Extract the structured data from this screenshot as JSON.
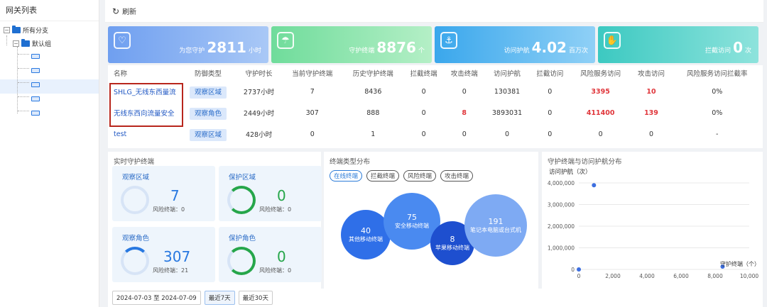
{
  "sidebar": {
    "title": "网关列表",
    "root": "所有分支",
    "group": "默认组"
  },
  "toolbar": {
    "refresh_label": "刷新"
  },
  "cards": [
    {
      "prefix": "为您守护",
      "value": "2811",
      "unit": "小时"
    },
    {
      "prefix": "守护终端",
      "value": "8876",
      "unit": "个"
    },
    {
      "prefix": "访问护航",
      "value": "4.02",
      "unit": "百万次"
    },
    {
      "prefix": "拦截访问",
      "value": "0",
      "unit": "次"
    }
  ],
  "table": {
    "headers": [
      "名称",
      "防御类型",
      "守护时长",
      "当前守护终端",
      "历史守护终端",
      "拦截终端",
      "攻击终端",
      "访问护航",
      "拦截访问",
      "风险服务访问",
      "攻击访问",
      "风险服务访问拦截率"
    ],
    "rows": [
      {
        "name": "SHLG_无线东西量流",
        "type": "观察区域",
        "duration": "2737小时",
        "cur": "7",
        "hist": "8436",
        "block": "0",
        "attack": "0",
        "visit": "130381",
        "blockv": "0",
        "risk": "3395",
        "atkv": "10",
        "rate": "0%"
      },
      {
        "name": "无线东西向流量安全",
        "type": "观察角色",
        "duration": "2449小时",
        "cur": "307",
        "hist": "888",
        "block": "0",
        "attack": "8",
        "visit": "3893031",
        "blockv": "0",
        "risk": "411400",
        "atkv": "139",
        "rate": "0%"
      },
      {
        "name": "test",
        "type": "观察区域",
        "duration": "428小时",
        "cur": "0",
        "hist": "1",
        "block": "0",
        "attack": "0",
        "visit": "0",
        "blockv": "0",
        "risk": "0",
        "atkv": "0",
        "rate": "-"
      }
    ]
  },
  "realtime": {
    "title": "实时守护终端",
    "items": [
      {
        "label": "观察区域",
        "value": "7",
        "sub": "风险终端：0"
      },
      {
        "label": "保护区域",
        "value": "0",
        "sub": "风险终端：0"
      },
      {
        "label": "观察角色",
        "value": "307",
        "sub": "风险终端：21"
      },
      {
        "label": "保护角色",
        "value": "0",
        "sub": "风险终端：0"
      }
    ]
  },
  "dist": {
    "title": "终端类型分布",
    "tabs": [
      "在线终端",
      "拦截终端",
      "风险终端",
      "攻击终端"
    ],
    "bubbles": [
      {
        "value": "40",
        "label": "其他移动终端",
        "color": "#2f6fe8"
      },
      {
        "value": "75",
        "label": "安全移动终端",
        "color": "#4a8af0"
      },
      {
        "value": "8",
        "label": "苹果移动终端",
        "color": "#1e4fcf"
      },
      {
        "value": "191",
        "label": "笔记本电脑或台式机",
        "color": "#7eaaf3"
      }
    ]
  },
  "scatter": {
    "title": "守护终端与访问护航分布",
    "ylabel": "访问护航（次）",
    "xlabel": "守护终端（个）",
    "yticks": [
      "4,000,000",
      "3,000,000",
      "2,000,000",
      "1,000,000",
      "0"
    ],
    "xticks": [
      "0",
      "2,000",
      "4,000",
      "6,000",
      "8,000",
      "10,000"
    ]
  },
  "chart_data": {
    "type": "scatter",
    "xlabel": "守护终端（个）",
    "ylabel": "访问护航（次）",
    "xlim": [
      0,
      10000
    ],
    "ylim": [
      0,
      4000000
    ],
    "points": [
      [
        888,
        3893031
      ],
      [
        8436,
        130381
      ],
      [
        1,
        0
      ]
    ]
  },
  "datebar": {
    "range": "2024-07-03 至 2024-07-09",
    "btn7": "最近7天",
    "btn30": "最近30天"
  }
}
